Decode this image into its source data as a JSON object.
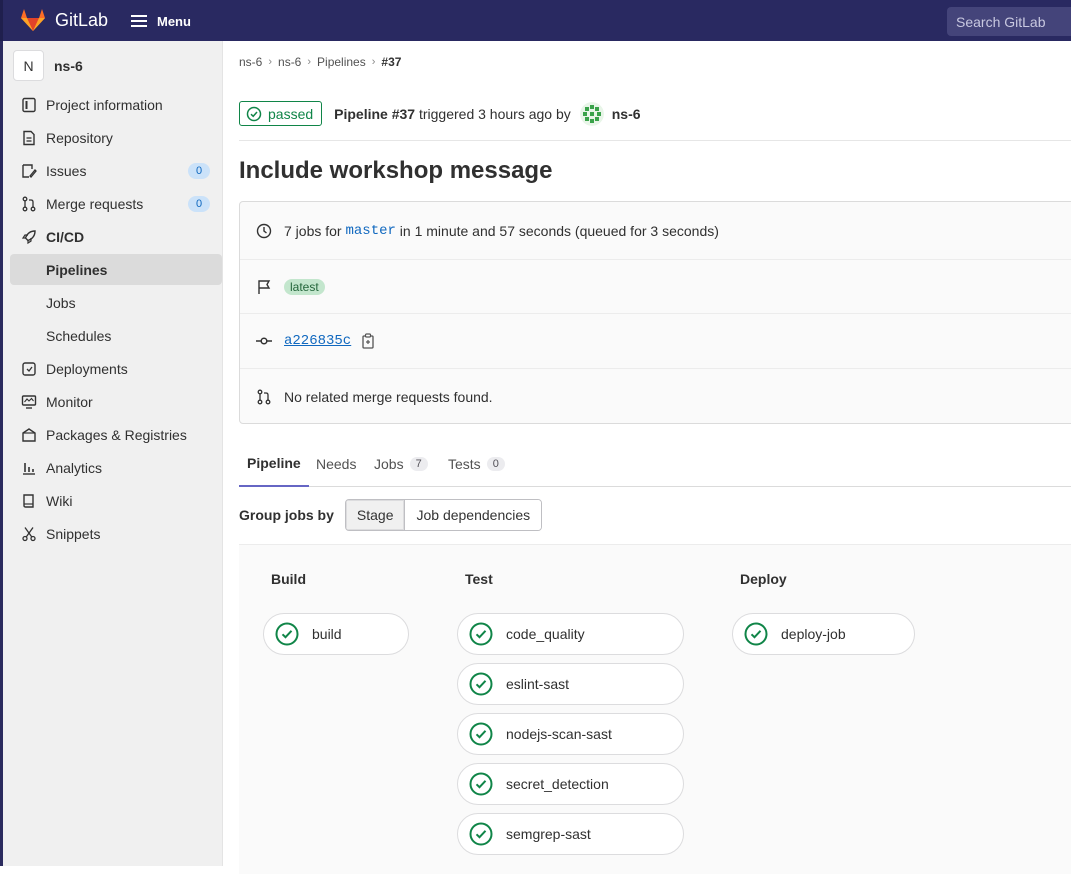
{
  "topbar": {
    "brand": "GitLab",
    "menu_label": "Menu",
    "search_placeholder": "Search GitLab"
  },
  "sidebar": {
    "project_initial": "N",
    "project_name": "ns-6",
    "items": [
      {
        "label": "Project information",
        "icon": "info-icon"
      },
      {
        "label": "Repository",
        "icon": "doc-icon"
      },
      {
        "label": "Issues",
        "icon": "issues-icon",
        "count": "0"
      },
      {
        "label": "Merge requests",
        "icon": "merge-request-icon",
        "count": "0"
      },
      {
        "label": "CI/CD",
        "icon": "rocket-icon"
      },
      {
        "label": "Pipelines"
      },
      {
        "label": "Jobs"
      },
      {
        "label": "Schedules"
      },
      {
        "label": "Deployments",
        "icon": "deployments-icon"
      },
      {
        "label": "Monitor",
        "icon": "monitor-icon"
      },
      {
        "label": "Packages & Registries",
        "icon": "package-icon"
      },
      {
        "label": "Analytics",
        "icon": "analytics-icon"
      },
      {
        "label": "Wiki",
        "icon": "book-icon"
      },
      {
        "label": "Snippets",
        "icon": "scissors-icon"
      }
    ]
  },
  "breadcrumb": [
    "ns-6",
    "ns-6",
    "Pipelines",
    "#37"
  ],
  "pipeline": {
    "status": "passed",
    "name": "Pipeline #37",
    "triggered": "triggered 3 hours ago by",
    "user": "ns-6",
    "title": "Include workshop message",
    "jobs_prefix": "7 jobs for",
    "branch": "master",
    "duration": "in 1 minute and 57 seconds (queued for 3 seconds)",
    "badge": "latest",
    "sha": "a226835c",
    "mr_text": "No related merge requests found."
  },
  "tabs": [
    {
      "label": "Pipeline"
    },
    {
      "label": "Needs"
    },
    {
      "label": "Jobs",
      "count": "7"
    },
    {
      "label": "Tests",
      "count": "0"
    }
  ],
  "group_by": {
    "label": "Group jobs by",
    "options": [
      "Stage",
      "Job dependencies"
    ],
    "selected": "Stage"
  },
  "stages": [
    {
      "name": "Build",
      "jobs": [
        "build"
      ]
    },
    {
      "name": "Test",
      "jobs": [
        "code_quality",
        "eslint-sast",
        "nodejs-scan-sast",
        "secret_detection",
        "semgrep-sast"
      ]
    },
    {
      "name": "Deploy",
      "jobs": [
        "deploy-job"
      ]
    }
  ],
  "colors": {
    "success": "#108548",
    "topbar": "#292961",
    "link": "#1068bf",
    "tab_active": "#6666c4"
  }
}
